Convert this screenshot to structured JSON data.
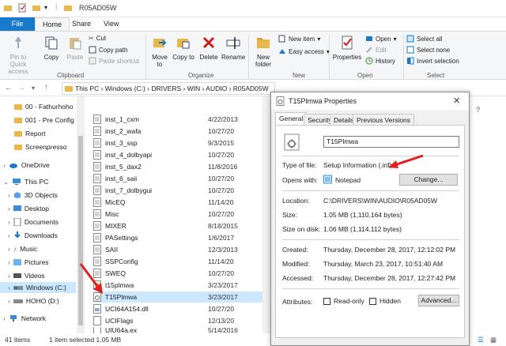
{
  "window": {
    "title": "R05AD05W"
  },
  "tabs": [
    "File",
    "Home",
    "Share",
    "View"
  ],
  "ribbon": {
    "clipboard": {
      "pin_label": "Pin to Quick access",
      "copy_label": "Copy",
      "paste_label": "Paste",
      "cut_label": "Cut",
      "copy_path_label": "Copy path",
      "paste_shortcut_label": "Paste shortcut",
      "group_label": "Clipboard"
    },
    "organize": {
      "move_label": "Move to",
      "copy_to_label": "Copy to",
      "delete_label": "Delete",
      "rename_label": "Rename",
      "group_label": "Organize"
    },
    "new": {
      "new_folder_label": "New folder",
      "new_item_label": "New item",
      "easy_access_label": "Easy access",
      "group_label": "New"
    },
    "open": {
      "properties_label": "Properties",
      "open_label": "Open",
      "edit_label": "Edit",
      "history_label": "History",
      "group_label": "Open"
    },
    "select": {
      "select_all_label": "Select all",
      "select_none_label": "Select none",
      "invert_label": "Invert selection",
      "group_label": "Select"
    }
  },
  "address": {
    "crumbs": "This PC  ›  Windows (C:)  ›  DRIVERS  ›  WIN  ›  AUDIO  ›  R05AD05W"
  },
  "nav": {
    "items": [
      {
        "label": "00 - Fathurhoho"
      },
      {
        "label": "001 - Pre Config"
      },
      {
        "label": "Report"
      },
      {
        "label": "Screenpresso"
      },
      {
        "label": "OneDrive"
      },
      {
        "label": "This PC"
      },
      {
        "label": "3D Objects"
      },
      {
        "label": "Desktop"
      },
      {
        "label": "Documents"
      },
      {
        "label": "Downloads"
      },
      {
        "label": "Music"
      },
      {
        "label": "Pictures"
      },
      {
        "label": "Videos"
      },
      {
        "label": "Windows (C:)"
      },
      {
        "label": "HOHO (D:)"
      },
      {
        "label": "Network"
      }
    ]
  },
  "files": [
    {
      "name": "inst_1_cxm",
      "date": "4/22/2013"
    },
    {
      "name": "inst_2_wafa",
      "date": "10/27/20"
    },
    {
      "name": "inst_3_ssp",
      "date": "9/3/2015"
    },
    {
      "name": "inst_4_dolbyapi",
      "date": "10/27/20"
    },
    {
      "name": "inst_5_dax2",
      "date": "11/8/2016"
    },
    {
      "name": "inst_6_saii",
      "date": "10/27/20"
    },
    {
      "name": "inst_7_dolbygui",
      "date": "10/27/20"
    },
    {
      "name": "MicEQ",
      "date": "11/14/20"
    },
    {
      "name": "Misc",
      "date": "10/27/20"
    },
    {
      "name": "MIXER",
      "date": "8/18/2015"
    },
    {
      "name": "PASettings",
      "date": "1/6/2017"
    },
    {
      "name": "SAII",
      "date": "12/3/2013"
    },
    {
      "name": "SSPConfig",
      "date": "11/14/20"
    },
    {
      "name": "SWEQ",
      "date": "10/27/20"
    },
    {
      "name": "t15plmwa",
      "date": "3/23/2017"
    },
    {
      "name": "T15Plmwa",
      "date": "3/23/2017"
    },
    {
      "name": "UCI64A154.dll",
      "date": "10/27/20"
    },
    {
      "name": "UCIFlags",
      "date": "12/13/20"
    },
    {
      "name": "UIU64a.ex_",
      "date": "5/14/2016"
    }
  ],
  "status": {
    "count": "41 items",
    "selection": "1 item selected  1.05 MB"
  },
  "dialog": {
    "title": "T15Plmwa Properties",
    "tabs": [
      "General",
      "Security",
      "Details",
      "Previous Versions"
    ],
    "name_value": "T15Plmwa",
    "type_label": "Type of file:",
    "type_value": "Setup Information (.inf)",
    "opens_label": "Opens with:",
    "opens_value": "Notepad",
    "change_label": "Change...",
    "location_label": "Location:",
    "location_value": "C:\\DRIVERS\\WIN\\AUDIO\\R05AD05W",
    "size_label": "Size:",
    "size_value": "1.05 MB (1,110,164 bytes)",
    "disk_label": "Size on disk:",
    "disk_value": "1.06 MB (1,114,112 bytes)",
    "created_label": "Created:",
    "created_value": "Thursday, December 28, 2017, 12:12:02 PM",
    "modified_label": "Modified:",
    "modified_value": "Thursday, March 23, 2017, 10:51:40 AM",
    "accessed_label": "Accessed:",
    "accessed_value": "Thursday, December 28, 2017, 12:27:42 PM",
    "attributes_label": "Attributes:",
    "readonly_label": "Read-only",
    "hidden_label": "Hidden",
    "advanced_label": "Advanced..."
  },
  "colors": {
    "accent": "#1979ca",
    "selection": "#cce8ff",
    "folder": "#e8b84a",
    "arrow": "#e02020"
  }
}
